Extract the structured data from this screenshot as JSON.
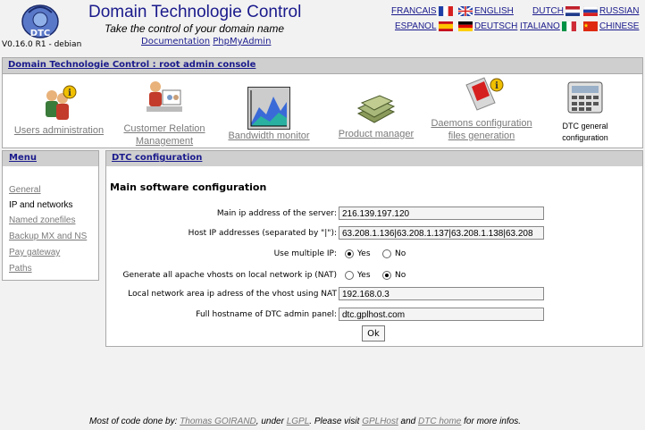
{
  "header": {
    "app_title": "Domain Technologie Control",
    "tagline": "Take the control of your domain name",
    "version": "V0.16.0 R1 - debian",
    "doc_link": "Documentation",
    "pma_link": "PhpMyAdmin",
    "logo_text": "DTC"
  },
  "languages": [
    {
      "label": "FRANCAIS",
      "flag": "fr"
    },
    {
      "label": "ENGLISH",
      "flag": "uk"
    },
    {
      "label": "DUTCH",
      "flag": "nl"
    },
    {
      "label": "RUSSIAN",
      "flag": "ru"
    },
    {
      "label": "ESPANOL",
      "flag": "es"
    },
    {
      "label": "DEUTSCH",
      "flag": "de"
    },
    {
      "label": "ITALIANO",
      "flag": "it"
    },
    {
      "label": "CHINESE",
      "flag": "cn"
    }
  ],
  "console": {
    "title": "Domain Technologie Control : root admin console",
    "tools": [
      {
        "line1": "Users administration",
        "line2": "",
        "icon": "users-icon"
      },
      {
        "line1": "Customer Relation",
        "line2": "Management",
        "icon": "crm-icon"
      },
      {
        "line1": "Bandwidth monitor",
        "line2": "",
        "icon": "bandwidth-graph-icon"
      },
      {
        "line1": "Product manager",
        "line2": "",
        "icon": "money-icon"
      },
      {
        "line1": "Daemons configuration",
        "line2": "files generation",
        "icon": "switch-icon"
      },
      {
        "line1": "DTC general",
        "line2": "configuration",
        "icon": "calculator-icon"
      }
    ]
  },
  "menu": {
    "title": "Menu",
    "items": [
      "General",
      "IP and networks",
      "Named zonefiles",
      "Backup MX and NS",
      "Pay gateway",
      "Paths"
    ],
    "current": "IP and networks"
  },
  "panel": {
    "title": "DTC configuration",
    "section": "Main software configuration",
    "main_ip_label": "Main ip address of the server:",
    "main_ip_value": "216.139.197.120",
    "host_ips_label": "Host IP addresses (separated by \"|\"):",
    "host_ips_value": "63.208.1.136|63.208.1.137|63.208.1.138|63.208",
    "multi_ip_label": "Use multiple IP:",
    "multi_ip_selected": "Yes",
    "nat_label": "Generate all apache vhosts on local network ip (NAT)",
    "nat_selected": "No",
    "lan_ip_label": "Local network area ip adress of the vhost using NAT",
    "lan_ip_value": "192.168.0.3",
    "hostname_label": "Full hostname of DTC admin panel:",
    "hostname_value": "dtc.gplhost.com",
    "yes": "Yes",
    "no": "No",
    "ok_label": "Ok"
  },
  "footer": {
    "prefix": "Most of code done by:",
    "author": "Thomas GOIRAND",
    "under": ", under",
    "license": "LGPL",
    "visit": ". Please visit",
    "site1": "GPLHost",
    "and": "and",
    "site2": "DTC home",
    "suffix": "for more infos."
  }
}
